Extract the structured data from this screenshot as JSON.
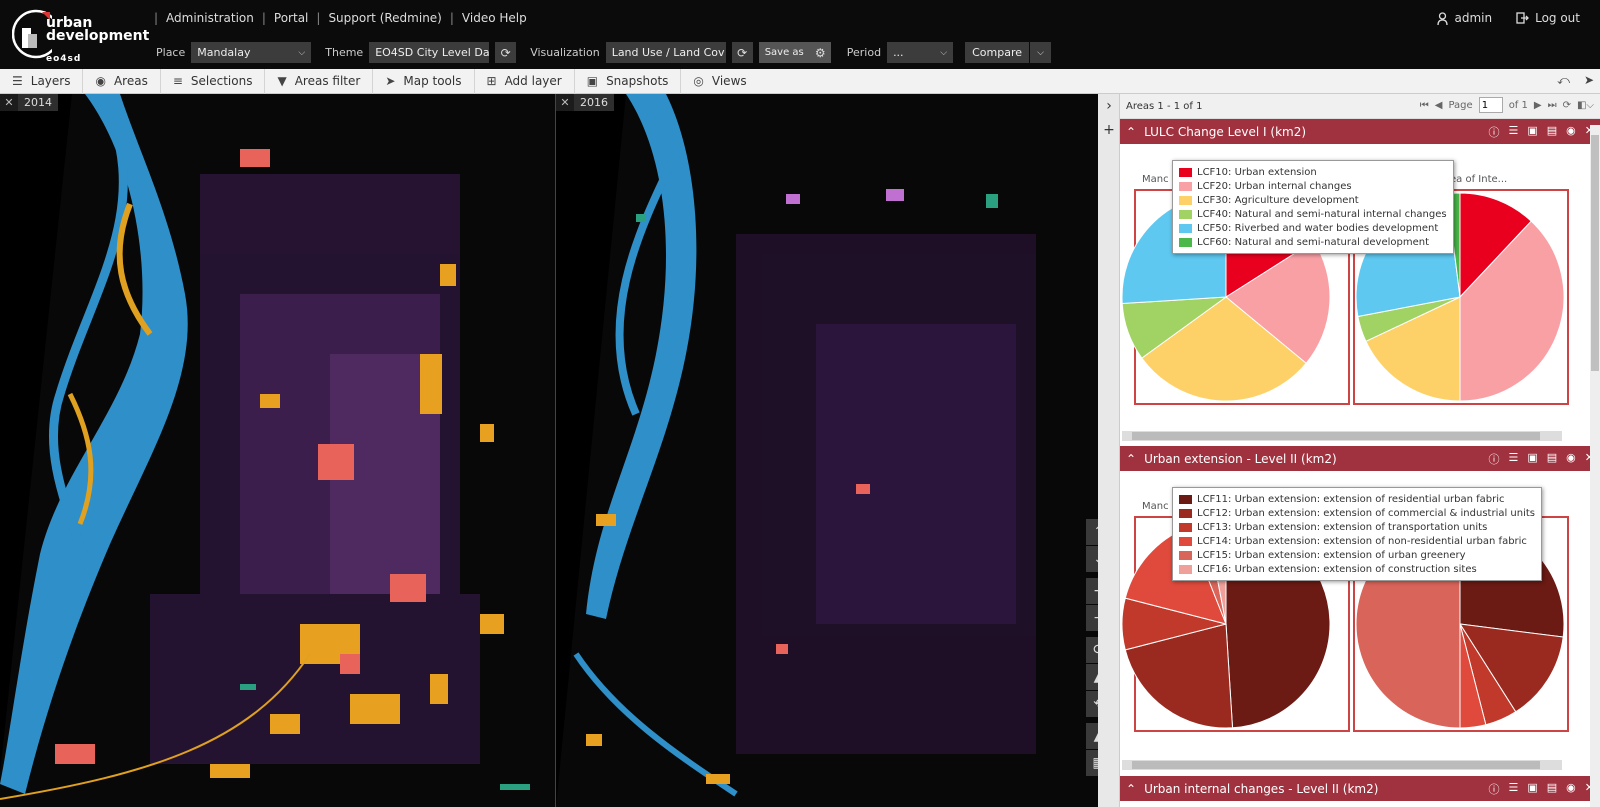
{
  "app": {
    "logo_line1": "urban",
    "logo_line2": "development",
    "logo_line3": "eo4sd"
  },
  "nav": {
    "links": [
      "Administration",
      "Portal",
      "Support (Redmine)",
      "Video Help"
    ],
    "user": "admin",
    "logout": "Log out"
  },
  "filters": {
    "place_label": "Place",
    "place_value": "Mandalay",
    "theme_label": "Theme",
    "theme_value": "EO4SD City Level Dat",
    "visualization_label": "Visualization",
    "visualization_value": "Land Use / Land Cov",
    "save_as": "Save as",
    "period_label": "Period",
    "period_value": "...",
    "compare": "Compare"
  },
  "toolbar": {
    "items": [
      "Layers",
      "Areas",
      "Selections",
      "Areas filter",
      "Map tools",
      "Add layer",
      "Snapshots",
      "Views"
    ]
  },
  "maps": {
    "left_year": "2014",
    "right_year": "2016"
  },
  "panel": {
    "pager": {
      "areas_text": "Areas 1 - 1 of 1",
      "page_label": "Page",
      "page_value": "1",
      "of_text": "of 1"
    },
    "sections": [
      {
        "title": "LULC Change Level I (km2)",
        "chart_title_left": "Manc",
        "chart_title_right": "ea of Inte..."
      },
      {
        "title": "Urban extension - Level II (km2)",
        "chart_title_left": "Manc"
      },
      {
        "title": "Urban internal changes - Level II (km2)"
      }
    ]
  },
  "chart_data": [
    {
      "type": "pie",
      "legend": [
        {
          "name": "LCF10: Urban extension",
          "color": "#e8001e"
        },
        {
          "name": "LCF20: Urban internal changes",
          "color": "#f9a0a5"
        },
        {
          "name": "LCF30: Agriculture development",
          "color": "#fdd168"
        },
        {
          "name": "LCF40: Natural and semi-natural internal changes",
          "color": "#a0d264"
        },
        {
          "name": "LCF50: Riverbed and water bodies development",
          "color": "#5ec8f0"
        },
        {
          "name": "LCF60: Natural and semi-natural development",
          "color": "#4ab84a"
        }
      ],
      "pies": [
        {
          "values": [
            0.16,
            0.2,
            0.29,
            0.09,
            0.26,
            0.0
          ]
        },
        {
          "values": [
            0.12,
            0.38,
            0.18,
            0.04,
            0.26,
            0.02
          ]
        }
      ]
    },
    {
      "type": "pie",
      "legend": [
        {
          "name": "LCF11: Urban extension: extension of residential urban fabric",
          "color": "#6b1a14"
        },
        {
          "name": "LCF12: Urban extension: extension of commercial & industrial units",
          "color": "#9a2a20"
        },
        {
          "name": "LCF13: Urban extension: extension of transportation units",
          "color": "#c0392b"
        },
        {
          "name": "LCF14: Urban extension: extension of non-residential urban fabric",
          "color": "#e04a3c"
        },
        {
          "name": "LCF15: Urban extension: extension of urban greenery",
          "color": "#d9645a"
        },
        {
          "name": "LCF16: Urban extension: extension of construction sites",
          "color": "#f0a09a"
        }
      ],
      "pies": [
        {
          "values": [
            0.49,
            0.22,
            0.08,
            0.15,
            0.03,
            0.03
          ]
        },
        {
          "values": [
            0.27,
            0.14,
            0.05,
            0.04,
            0.5,
            0.0
          ]
        }
      ]
    }
  ]
}
